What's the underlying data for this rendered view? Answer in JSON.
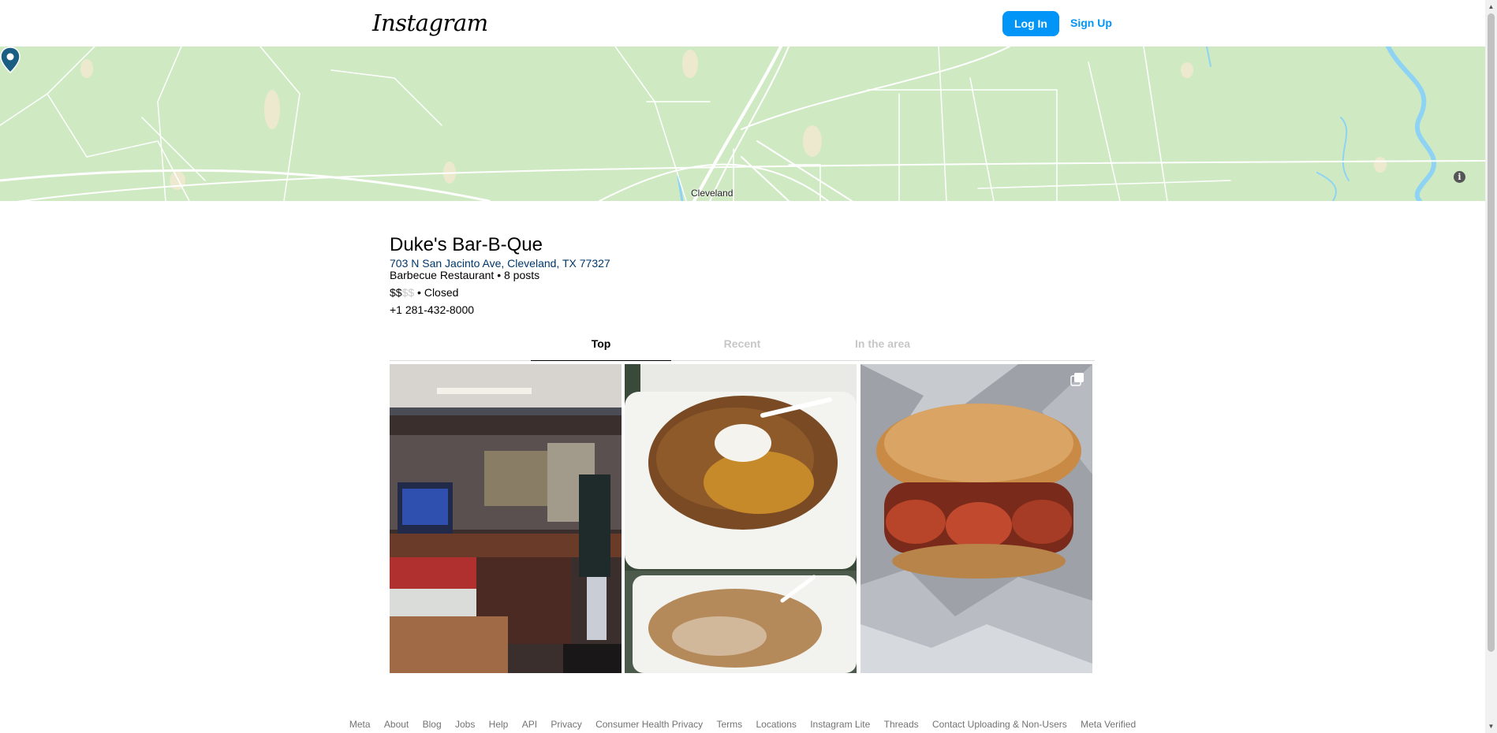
{
  "header": {
    "logo": "Instagram",
    "login_label": "Log In",
    "signup_label": "Sign Up"
  },
  "map": {
    "city_label": "Cleveland",
    "info_label": "i",
    "colors": {
      "land": "#cfeac3",
      "road": "#ffffff",
      "water": "#8fd3f4",
      "pin": "#1b5e84"
    }
  },
  "place": {
    "name": "Duke's Bar-B-Que",
    "address": "703 N San Jacinto Ave, Cleveland, TX 77327",
    "meta": "Barbecue Restaurant • 8 posts",
    "price_active": "$$",
    "price_inactive": "$$",
    "status": " • Closed",
    "phone": "+1 281-432-8000"
  },
  "tabs": [
    {
      "label": "Top",
      "active": true
    },
    {
      "label": "Recent",
      "active": false
    },
    {
      "label": "In the area",
      "active": false
    }
  ],
  "posts": [
    {
      "icon": "restaurant-interior-photo"
    },
    {
      "icon": "loaded-baked-potato-photo"
    },
    {
      "icon": "sausage-sandwich-photo",
      "multi": true
    }
  ],
  "footer": {
    "links": [
      "Meta",
      "About",
      "Blog",
      "Jobs",
      "Help",
      "API",
      "Privacy",
      "Consumer Health Privacy",
      "Terms",
      "Locations",
      "Instagram Lite",
      "Threads",
      "Contact Uploading & Non-Users",
      "Meta Verified"
    ]
  },
  "colors": {
    "accent": "#0095f6",
    "link": "#00376b",
    "muted": "#737373"
  }
}
